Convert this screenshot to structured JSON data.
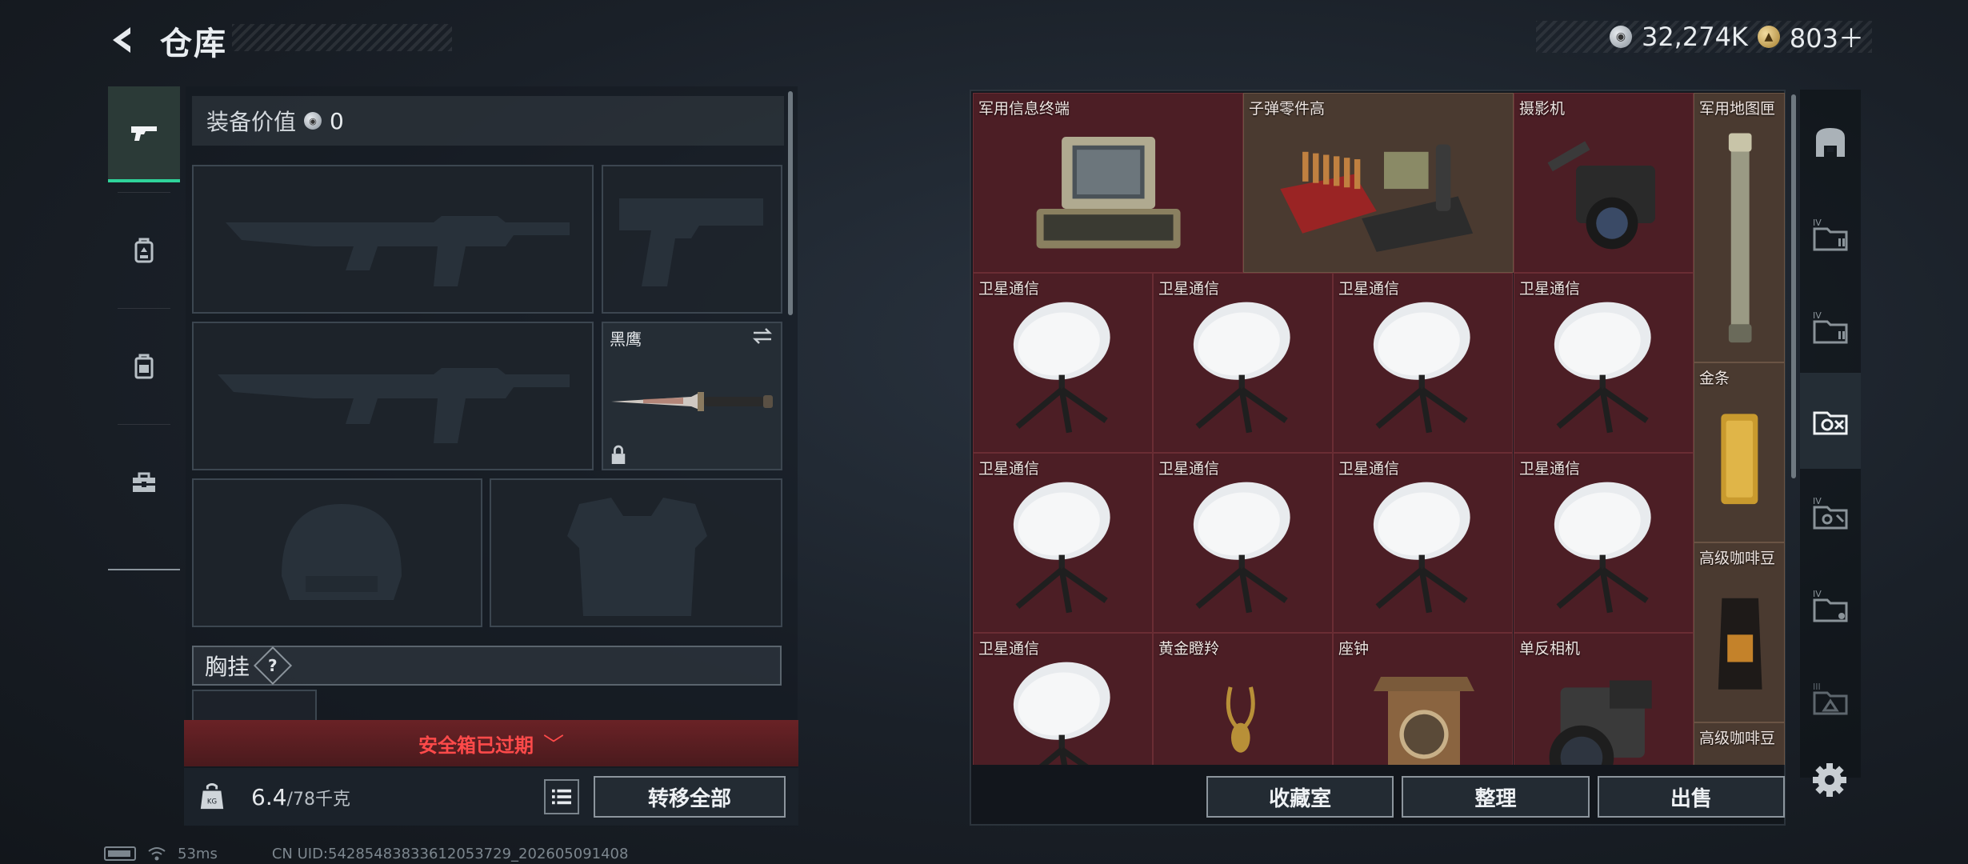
{
  "header": {
    "title": "仓库",
    "currency": [
      {
        "icon": "silver-coin-icon",
        "value": "32,274K"
      },
      {
        "icon": "gold-coin-icon",
        "value": "803＋"
      }
    ]
  },
  "left_tabs": [
    {
      "name": "pistol-tab-icon",
      "active": true
    },
    {
      "name": "backpack-tab-icon",
      "active": false
    },
    {
      "name": "case-tab-icon",
      "active": false
    },
    {
      "name": "toolbox-tab-icon",
      "active": false
    }
  ],
  "equipment": {
    "value_label": "装备价值",
    "value": "0",
    "slots": {
      "knife_name": "黑鹰"
    },
    "chest_label": "胸挂",
    "chest_help": "?",
    "safe_box_status": "安全箱已过期",
    "weight_main": "6.4",
    "weight_rest": "/78千克",
    "transfer_all": "转移全部"
  },
  "stash": {
    "items": [
      {
        "name": "军用信息终端",
        "type": "terminal"
      },
      {
        "name": "子弹零件高",
        "type": "ammo"
      },
      {
        "name": "摄影机",
        "type": "camcorder"
      },
      {
        "name": "军用地图匣",
        "type": "tube"
      },
      {
        "name": "卫星通信",
        "type": "dish"
      },
      {
        "name": "卫星通信",
        "type": "dish"
      },
      {
        "name": "卫星通信",
        "type": "dish"
      },
      {
        "name": "卫星通信",
        "type": "dish"
      },
      {
        "name": "金条",
        "type": "gold"
      },
      {
        "name": "卫星通信",
        "type": "dish"
      },
      {
        "name": "卫星通信",
        "type": "dish"
      },
      {
        "name": "卫星通信",
        "type": "dish"
      },
      {
        "name": "卫星通信",
        "type": "dish"
      },
      {
        "name": "高级咖啡豆",
        "type": "coffee"
      },
      {
        "name": "卫星通信",
        "type": "dish"
      },
      {
        "name": "黄金瞪羚",
        "type": "gazelle"
      },
      {
        "name": "座钟",
        "type": "clock"
      },
      {
        "name": "单反相机",
        "type": "camera"
      },
      {
        "name": "高级咖啡豆",
        "type": "coffee"
      }
    ],
    "buttons": {
      "collection": "收藏室",
      "sort": "整理",
      "sell": "出售"
    }
  },
  "status": {
    "ping": "53ms",
    "uid": "CN UID:54285483833612053729_202605091408"
  },
  "colors": {
    "active_accent": "#2fd39a",
    "warning_red": "#ff4a4a",
    "cell_red": "#4c1e25"
  }
}
